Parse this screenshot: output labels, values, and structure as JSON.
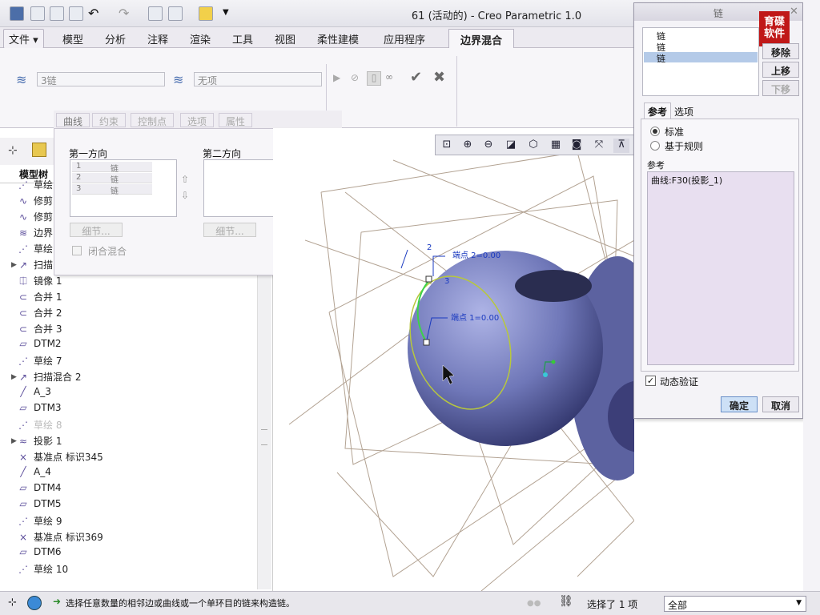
{
  "window": {
    "title": "61 (活动的) - Creo Parametric 1.0"
  },
  "menu": {
    "file": "文件",
    "items": [
      "模型",
      "分析",
      "注释",
      "渲染",
      "工具",
      "视图",
      "柔性建模",
      "应用程序"
    ],
    "active_tab": "边界混合"
  },
  "ribbon": {
    "first_dir_value": "3链",
    "second_dir_value": "无项"
  },
  "subtabs": [
    "曲线",
    "约束",
    "控制点",
    "选项",
    "属性"
  ],
  "panel": {
    "first_dir_label": "第一方向",
    "second_dir_label": "第二方向",
    "first_list": [
      {
        "num": "1",
        "label": "链"
      },
      {
        "num": "2",
        "label": "链"
      },
      {
        "num": "3",
        "label": "链"
      }
    ],
    "details_label": "细节...",
    "closed_blend_label": "闭合混合"
  },
  "tree": {
    "header": "模型树",
    "items": [
      {
        "label": "草绘",
        "icon": "sketch-icon",
        "expand": false
      },
      {
        "label": "修剪",
        "icon": "trim-icon",
        "expand": false
      },
      {
        "label": "修剪",
        "icon": "trim-icon",
        "expand": false
      },
      {
        "label": "边界",
        "icon": "boundary-blend-icon",
        "expand": false
      },
      {
        "label": "草绘",
        "icon": "sketch-icon",
        "expand": false
      },
      {
        "label": "扫描",
        "icon": "sweep-icon",
        "expand": true
      },
      {
        "label": "镜像 1",
        "icon": "mirror-icon",
        "expand": false
      },
      {
        "label": "合并 1",
        "icon": "merge-icon",
        "expand": false
      },
      {
        "label": "合并 2",
        "icon": "merge-icon",
        "expand": false
      },
      {
        "label": "合并 3",
        "icon": "merge-icon",
        "expand": false
      },
      {
        "label": "DTM2",
        "icon": "datum-plane-icon",
        "expand": false
      },
      {
        "label": "草绘 7",
        "icon": "sketch-icon",
        "expand": false
      },
      {
        "label": "扫描混合 2",
        "icon": "sweep-blend-icon",
        "expand": true
      },
      {
        "label": "A_3",
        "icon": "datum-axis-icon",
        "expand": false
      },
      {
        "label": "DTM3",
        "icon": "datum-plane-icon",
        "expand": false
      },
      {
        "label": "草绘 8",
        "icon": "sketch-icon",
        "expand": false,
        "dim": true
      },
      {
        "label": "投影 1",
        "icon": "projection-icon",
        "expand": true
      },
      {
        "label": "基准点 标识345",
        "icon": "datum-point-icon",
        "expand": false
      },
      {
        "label": "A_4",
        "icon": "datum-axis-icon",
        "expand": false
      },
      {
        "label": "DTM4",
        "icon": "datum-plane-icon",
        "expand": false
      },
      {
        "label": "DTM5",
        "icon": "datum-plane-icon",
        "expand": false
      },
      {
        "label": "草绘 9",
        "icon": "sketch-icon",
        "expand": false
      },
      {
        "label": "基准点 标识369",
        "icon": "datum-point-icon",
        "expand": false
      },
      {
        "label": "DTM6",
        "icon": "datum-plane-icon",
        "expand": false
      },
      {
        "label": "草绘 10",
        "icon": "sketch-icon",
        "expand": false
      }
    ]
  },
  "viewport": {
    "annotations": {
      "endpoint2": "端点 2=0.00",
      "endpoint1": "端点 1=0.00",
      "num2": "2",
      "num3": "3"
    }
  },
  "dialog": {
    "title": "链",
    "chain_list": [
      "链",
      "链",
      "链"
    ],
    "remove_label": "移除",
    "up_label": "上移",
    "down_label": "下移",
    "tab_ref": "参考",
    "tab_options": "选项",
    "radio_standard": "标准",
    "radio_rule": "基于规则",
    "ref_label": "参考",
    "ref_value": "曲线:F30(投影_1)",
    "dynamic_verify": "动态验证",
    "ok_label": "确定",
    "cancel_label": "取消",
    "logo_line1": "育碟",
    "logo_line2": "软件"
  },
  "status": {
    "message": "选择任意数量的相邻边或曲线或一个单环目的链来构造链。",
    "selected": "选择了 1 项",
    "filter": "全部"
  }
}
